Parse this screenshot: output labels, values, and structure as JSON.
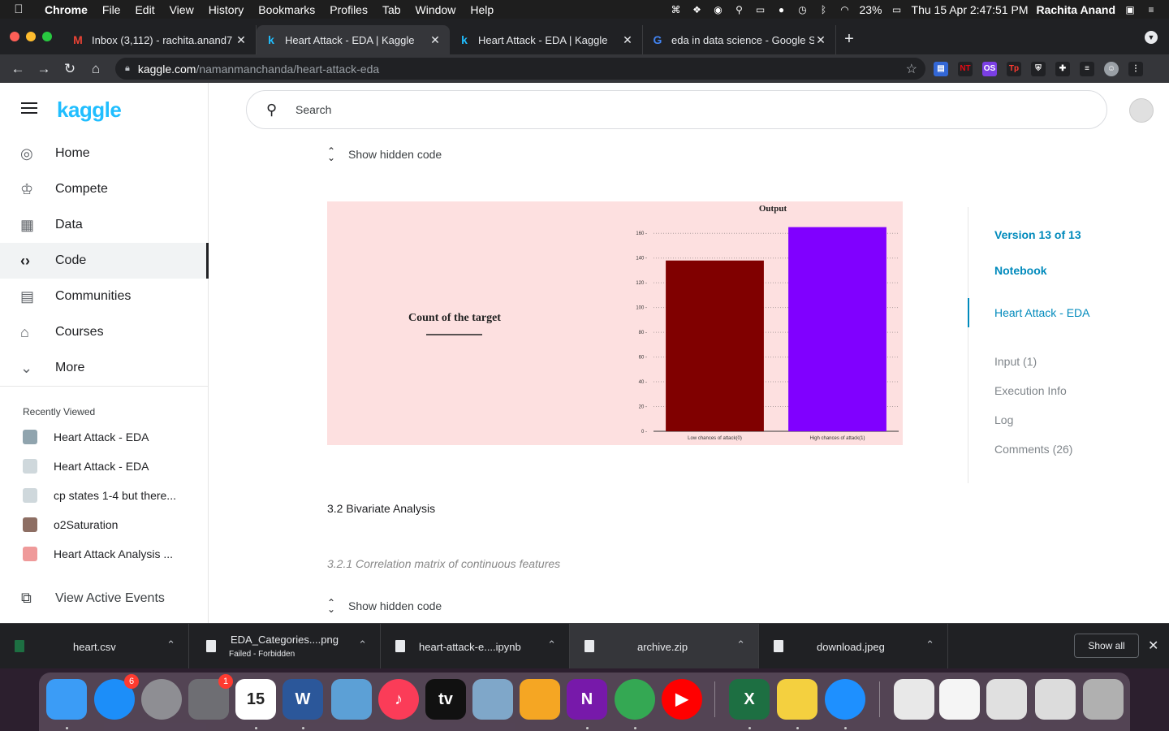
{
  "menubar": {
    "app": "Chrome",
    "items": [
      "File",
      "Edit",
      "View",
      "History",
      "Bookmarks",
      "Profiles",
      "Tab",
      "Window",
      "Help"
    ],
    "battery": "23%",
    "datetime": "Thu 15 Apr  2:47:51 PM",
    "user": "Rachita Anand"
  },
  "tabs": [
    {
      "title": "Inbox (3,112) - rachita.anand7",
      "favicon": "M",
      "color": "#ea4335"
    },
    {
      "title": "Heart Attack - EDA | Kaggle",
      "favicon": "k",
      "color": "#20beff"
    },
    {
      "title": "Heart Attack - EDA | Kaggle",
      "favicon": "k",
      "color": "#20beff"
    },
    {
      "title": "eda in data science - Google S",
      "favicon": "G",
      "color": "#4285f4"
    }
  ],
  "address": {
    "host": "kaggle.com",
    "path": "/namanmanchanda/heart-attack-eda"
  },
  "sidebar": {
    "logo": "kaggle",
    "nav": [
      {
        "label": "Home",
        "icon": "compass-icon",
        "glyph": "◎"
      },
      {
        "label": "Compete",
        "icon": "trophy-icon",
        "glyph": "♔"
      },
      {
        "label": "Data",
        "icon": "table-icon",
        "glyph": "▦"
      },
      {
        "label": "Code",
        "icon": "code-icon",
        "glyph": "‹›"
      },
      {
        "label": "Communities",
        "icon": "comment-icon",
        "glyph": "▤"
      },
      {
        "label": "Courses",
        "icon": "school-icon",
        "glyph": "⌂"
      },
      {
        "label": "More",
        "icon": "chevron-down-icon",
        "glyph": "⌄"
      }
    ],
    "recently_viewed_title": "Recently Viewed",
    "recent": [
      "Heart Attack - EDA",
      "Heart Attack - EDA",
      "cp states 1-4 but there...",
      "o2Saturation",
      "Heart Attack Analysis ..."
    ],
    "view_active_events": "View Active Events"
  },
  "search": {
    "placeholder": "Search"
  },
  "content": {
    "show_hidden_code": "Show hidden code",
    "section_title": "3.2 Bivariate Analysis",
    "subsection_title": "3.2.1 Correlation matrix of continuous features"
  },
  "toc": {
    "version": "Version 13 of 13",
    "notebook": "Notebook",
    "current": "Heart Attack - EDA",
    "items": [
      "Input (1)",
      "Execution Info",
      "Log",
      "Comments (26)"
    ]
  },
  "chart_data": {
    "type": "bar",
    "title": "Output",
    "side_text": "Count of the target",
    "categories": [
      "Low chances of attack(0)",
      "High chances of attack(1)"
    ],
    "values": [
      138,
      165
    ],
    "colors": [
      "#800000",
      "#8000ff"
    ],
    "ylim": [
      0,
      170
    ],
    "yticks": [
      0,
      20,
      40,
      60,
      80,
      100,
      120,
      140,
      160
    ],
    "grid": "horizontal dotted"
  },
  "downloads": [
    {
      "name": "heart.csv",
      "status": ""
    },
    {
      "name": "EDA_Categories....png",
      "status": "Failed - Forbidden"
    },
    {
      "name": "heart-attack-e....ipynb",
      "status": ""
    },
    {
      "name": "archive.zip",
      "status": ""
    },
    {
      "name": "download.jpeg",
      "status": ""
    }
  ],
  "show_all": "Show all",
  "dock": {
    "apps": [
      {
        "name": "finder-icon",
        "color": "#3b9cf6"
      },
      {
        "name": "app-store-icon",
        "color": "#1c8ef9",
        "badge": "6"
      },
      {
        "name": "launchpad-icon",
        "color": "#8e8e93"
      },
      {
        "name": "system-preferences-icon",
        "color": "#6e6e73",
        "badge": "1"
      },
      {
        "name": "calendar-icon",
        "color": "#ffffff",
        "label": "15"
      },
      {
        "name": "word-icon",
        "color": "#2b579a",
        "label": "W"
      },
      {
        "name": "preview-icon",
        "color": "#5ca0d6"
      },
      {
        "name": "music-icon",
        "color": "#fb3c58",
        "label": "♪"
      },
      {
        "name": "apple-tv-icon",
        "color": "#111111",
        "label": "tv"
      },
      {
        "name": "image-capture-icon",
        "color": "#7fa7c9"
      },
      {
        "name": "pages-icon",
        "color": "#f5a623"
      },
      {
        "name": "onenote-icon",
        "color": "#7719aa",
        "label": "N"
      },
      {
        "name": "chrome-icon",
        "color": "#34a853"
      },
      {
        "name": "youtube-music-icon",
        "color": "#ff0000",
        "label": "▶"
      },
      {
        "name": "excel-icon",
        "color": "#1d6f42",
        "label": "X"
      },
      {
        "name": "python-icon",
        "color": "#f4d03f"
      },
      {
        "name": "safari-icon",
        "color": "#1e90ff"
      },
      {
        "name": "csv-file-icon",
        "color": "#e8e8e8"
      },
      {
        "name": "document-preview-icon",
        "color": "#f5f5f5"
      },
      {
        "name": "excel-file-icon",
        "color": "#e0e0e0"
      },
      {
        "name": "word-file-icon",
        "color": "#dcdcdc"
      },
      {
        "name": "trash-icon",
        "color": "#b0b0b0"
      }
    ]
  }
}
